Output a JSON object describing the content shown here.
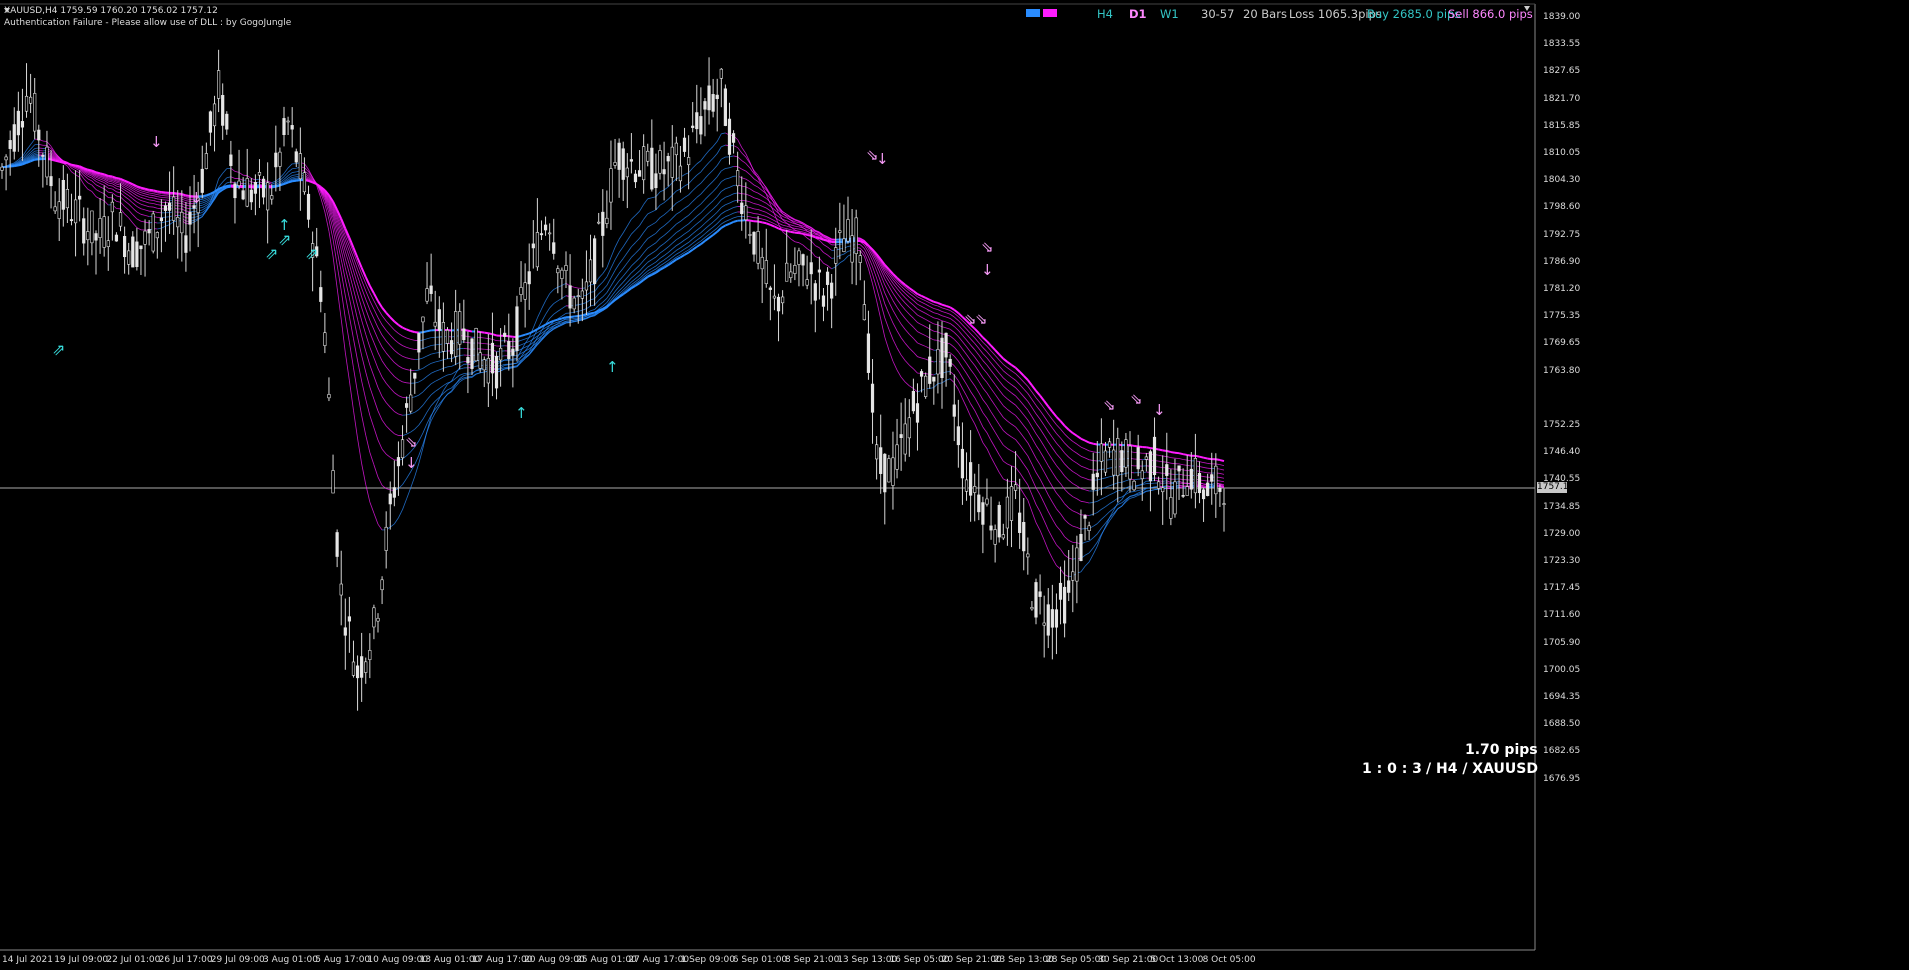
{
  "header": {
    "symbol_line": "XAUUSD,H4  1759.59 1760.20 1756.02 1757.12",
    "auth_message": "Authentication Failure - Please allow use of DLL : by GogoJungle"
  },
  "top_panel": {
    "tf_h4": "H4",
    "tf_d1": "D1",
    "tf_w1": "W1",
    "range": "30-57",
    "bars": "20 Bars",
    "loss": "Loss 1065.3pips",
    "buy": "Buy 2685.0 pips",
    "sell": "Sell 866.0 pips",
    "colors": {
      "blue": "#2a8cff",
      "magenta": "#ff1cff",
      "cyan": "#34c6c6",
      "pink": "#ff88ff"
    }
  },
  "price_axis": {
    "labels": [
      "1839.00",
      "1833.55",
      "1827.65",
      "1821.70",
      "1815.85",
      "1810.05",
      "1804.30",
      "1798.60",
      "1792.75",
      "1786.90",
      "1781.20",
      "1775.35",
      "1769.65",
      "1763.80",
      "1757.12",
      "1752.25",
      "1746.40",
      "1740.55",
      "1734.85",
      "1729.00",
      "1723.30",
      "1717.45",
      "1711.60",
      "1705.90",
      "1700.05",
      "1694.35",
      "1688.50",
      "1682.65",
      "1676.95"
    ],
    "current": "1757.12"
  },
  "time_axis": {
    "labels": [
      "14 Jul 2021",
      "19 Jul 09:00",
      "22 Jul 01:00",
      "26 Jul 17:00",
      "29 Jul 09:00",
      "3 Aug 01:00",
      "5 Aug 17:00",
      "10 Aug 09:00",
      "13 Aug 01:00",
      "17 Aug 17:00",
      "20 Aug 09:00",
      "25 Aug 01:00",
      "27 Aug 17:00",
      "1 Sep 09:00",
      "6 Sep 01:00",
      "8 Sep 21:00",
      "13 Sep 13:00",
      "16 Sep 05:00",
      "20 Sep 21:00",
      "23 Sep 13:00",
      "28 Sep 05:00",
      "30 Sep 21:00",
      "5 Oct 13:00",
      "8 Oct 05:00"
    ]
  },
  "info_box": {
    "pips": "1.70 pips",
    "ratio": "1 : 0 : 3",
    "symbol_tf": "/ H4 / XAUUSD"
  },
  "chart_data": {
    "type": "candlestick",
    "symbol": "XAUUSD",
    "timeframe": "H4",
    "ylim": [
      1676.95,
      1839.0
    ],
    "current_price": 1757.12,
    "path_points": [
      [
        0,
        1812
      ],
      [
        3,
        1826
      ],
      [
        6,
        1808
      ],
      [
        9,
        1804
      ],
      [
        11,
        1800
      ],
      [
        13,
        1804
      ],
      [
        15,
        1798
      ],
      [
        17,
        1800
      ],
      [
        19,
        1806
      ],
      [
        21,
        1800
      ],
      [
        23,
        1810
      ],
      [
        25,
        1826
      ],
      [
        27,
        1810
      ],
      [
        29,
        1808
      ],
      [
        31,
        1808
      ],
      [
        33,
        1820
      ],
      [
        35,
        1808
      ],
      [
        37,
        1790
      ],
      [
        39,
        1740
      ],
      [
        41,
        1725
      ],
      [
        43,
        1733
      ],
      [
        45,
        1755
      ],
      [
        47,
        1772
      ],
      [
        49,
        1790
      ],
      [
        51,
        1783
      ],
      [
        53,
        1784
      ],
      [
        55,
        1780
      ],
      [
        57,
        1778
      ],
      [
        59,
        1782
      ],
      [
        61,
        1795
      ],
      [
        63,
        1805
      ],
      [
        65,
        1792
      ],
      [
        67,
        1788
      ],
      [
        69,
        1800
      ],
      [
        71,
        1815
      ],
      [
        73,
        1813
      ],
      [
        75,
        1812
      ],
      [
        77,
        1812
      ],
      [
        79,
        1815
      ],
      [
        81,
        1822
      ],
      [
        83,
        1826
      ],
      [
        85,
        1810
      ],
      [
        87,
        1799
      ],
      [
        89,
        1788
      ],
      [
        91,
        1794
      ],
      [
        93,
        1795
      ],
      [
        95,
        1790
      ],
      [
        97,
        1800
      ],
      [
        99,
        1800
      ],
      [
        101,
        1760
      ],
      [
        103,
        1760
      ],
      [
        105,
        1770
      ],
      [
        107,
        1777
      ],
      [
        109,
        1780
      ],
      [
        111,
        1760
      ],
      [
        113,
        1755
      ],
      [
        115,
        1750
      ],
      [
        117,
        1755
      ],
      [
        119,
        1738
      ],
      [
        121,
        1735
      ],
      [
        123,
        1738
      ],
      [
        125,
        1750
      ],
      [
        127,
        1762
      ],
      [
        129,
        1763
      ],
      [
        131,
        1760
      ],
      [
        133,
        1762
      ],
      [
        135,
        1755
      ],
      [
        137,
        1760
      ],
      [
        139,
        1756
      ],
      [
        141,
        1758
      ]
    ]
  }
}
